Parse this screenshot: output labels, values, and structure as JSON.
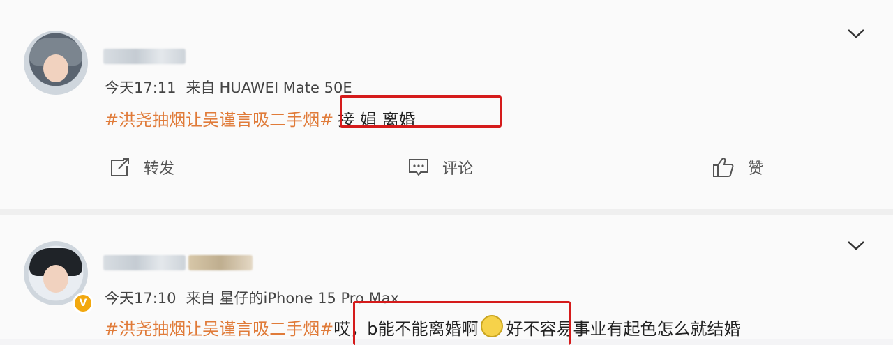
{
  "posts": [
    {
      "time": "今天17:11",
      "source_prefix": "来自",
      "device": "HUAWEI Mate 50E",
      "hashtag": "#洪尧抽烟让吴谨言吸二手烟#",
      "text": "接 娟 离婚",
      "actions": {
        "repost": "转发",
        "comment": "评论",
        "like": "赞"
      }
    },
    {
      "time": "今天17:10",
      "source_prefix": "来自",
      "device": "星仔的iPhone 15 Pro Max",
      "hashtag": "#洪尧抽烟让吴谨言吸二手烟#",
      "text": "哎，b能不能离婚啊",
      "text_after": "好不容易事业有起色怎么就结婚",
      "verified_badge": "V"
    }
  ],
  "colors": {
    "hashtag": "#e07b39",
    "highlight": "#d51b1b",
    "badge": "#f2a80f"
  },
  "icons": [
    "chevron-down-icon",
    "repost-icon",
    "comment-icon",
    "like-icon",
    "emoji-icon"
  ]
}
